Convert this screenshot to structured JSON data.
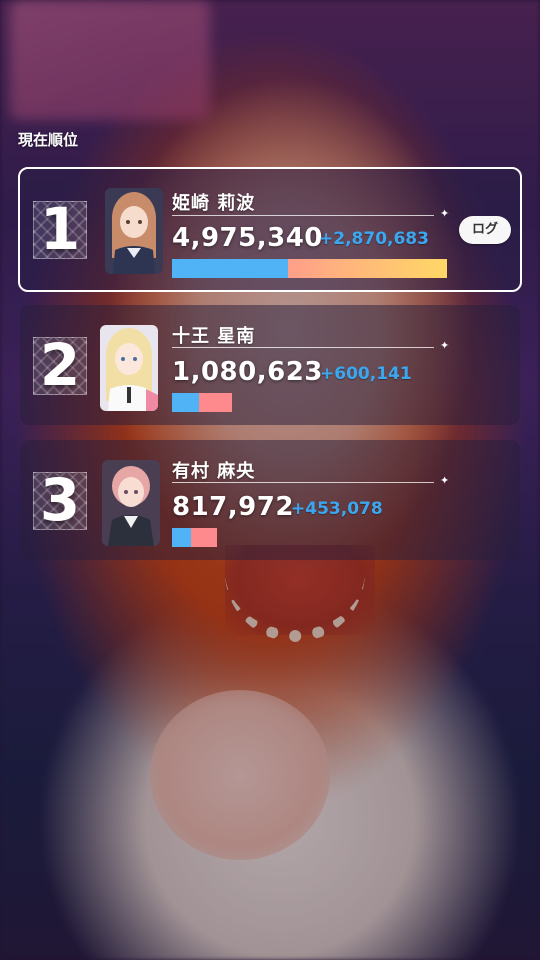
{
  "header": {
    "title": "現在順位"
  },
  "ranking": [
    {
      "rank": "1",
      "name": "姫崎 莉波",
      "score": "4,975,340",
      "delta": "+2,870,683",
      "bar_fraction": 1.0,
      "bar_blue_fraction": 0.42,
      "log_button": "ログ",
      "hair_color": "#c98c6b"
    },
    {
      "rank": "2",
      "name": "十王 星南",
      "score": "1,080,623",
      "delta": "+600,141",
      "bar_fraction": 0.217,
      "bar_blue_fraction": 0.45,
      "hair_color": "#f2dfa5"
    },
    {
      "rank": "3",
      "name": "有村 麻央",
      "score": "817,972",
      "delta": "+453,078",
      "bar_fraction": 0.164,
      "bar_blue_fraction": 0.43,
      "hair_color": "#e6a6a6"
    }
  ],
  "colors": {
    "bar_blue": "#4fb3f6",
    "bar_gradient_start": "#ff9f8a",
    "bar_gradient_end": "#ffd866",
    "bar_pink": "#ff8a8e",
    "delta_blue": "#3aa7f0"
  }
}
